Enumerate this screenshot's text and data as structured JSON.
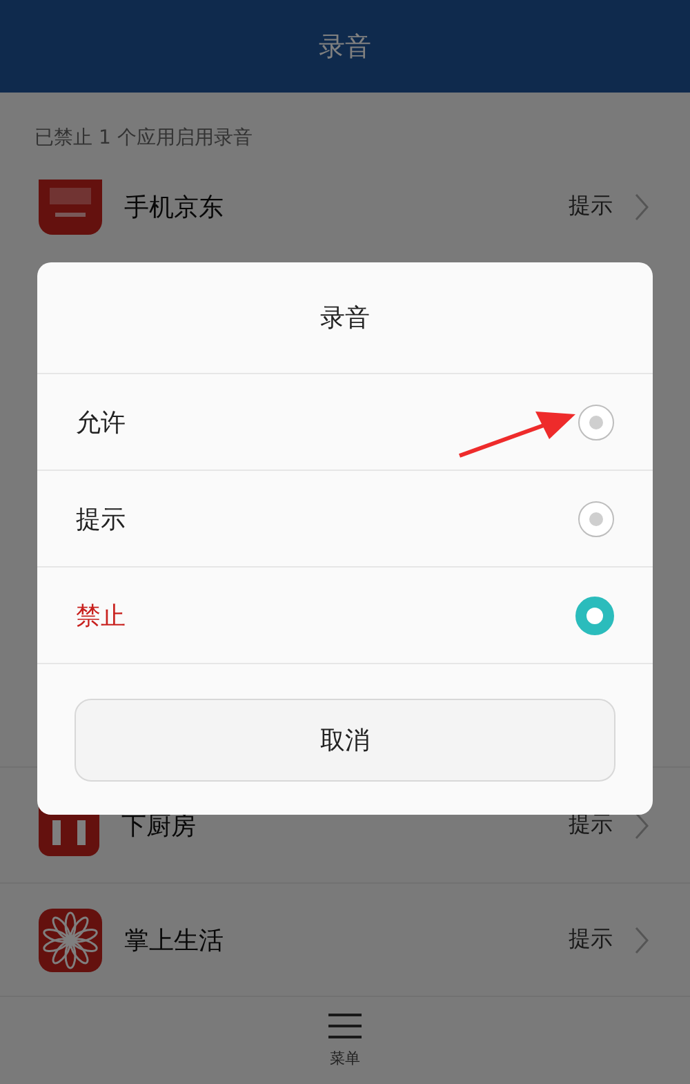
{
  "header": {
    "title": "录音"
  },
  "summary": "已禁止 1 个应用启用录音",
  "apps_top": [
    {
      "name": "手机京东",
      "setting": "提示",
      "kind": "jd"
    }
  ],
  "apps_bottom": [
    {
      "name": "下厨房",
      "setting": "提示",
      "kind": "kitchen"
    },
    {
      "name": "掌上生活",
      "setting": "提示",
      "kind": "flower"
    }
  ],
  "dialog": {
    "title": "录音",
    "options": [
      {
        "label": "允许",
        "selected": false,
        "danger": false
      },
      {
        "label": "提示",
        "selected": false,
        "danger": false
      },
      {
        "label": "禁止",
        "selected": true,
        "danger": true
      }
    ],
    "cancel": "取消"
  },
  "annotation": {
    "kind": "arrow"
  },
  "bottom_bar": {
    "label": "菜单"
  }
}
